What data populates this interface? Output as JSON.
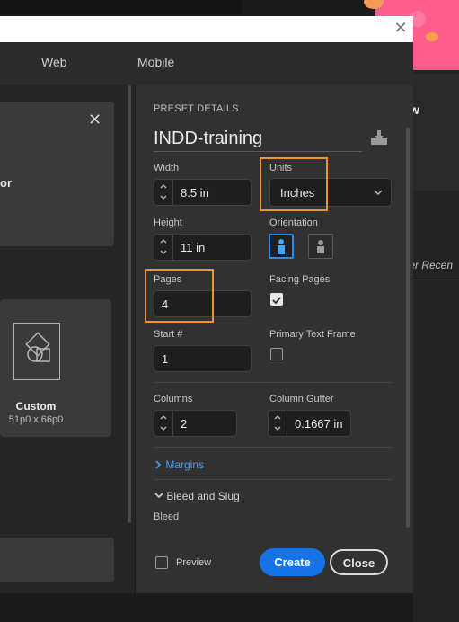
{
  "tabs": [
    "Web",
    "Mobile"
  ],
  "background": {
    "letter": "w",
    "recent_text": "ter Recen"
  },
  "left_panel": {
    "card1_text": "or",
    "card2_title": "Custom",
    "card2_subtitle": "51p0 x 66p0"
  },
  "preset": {
    "section_title": "PRESET DETAILS",
    "document_name": "INDD-training",
    "width_label": "Width",
    "width_value": "8.5 in",
    "units_label": "Units",
    "units_value": "Inches",
    "height_label": "Height",
    "height_value": "11 in",
    "orientation_label": "Orientation",
    "pages_label": "Pages",
    "pages_value": "4",
    "facing_pages_label": "Facing Pages",
    "facing_pages_checked": true,
    "start_label": "Start #",
    "start_value": "1",
    "primary_text_frame_label": "Primary Text Frame",
    "primary_text_frame_checked": false,
    "columns_label": "Columns",
    "columns_value": "2",
    "column_gutter_label": "Column Gutter",
    "column_gutter_value": "0.1667 in",
    "margins_label": "Margins",
    "bleed_slug_label": "Bleed and Slug",
    "bleed_label": "Bleed"
  },
  "footer": {
    "preview_label": "Preview",
    "create_label": "Create",
    "close_label": "Close"
  },
  "colors": {
    "accent_blue": "#1473e6",
    "highlight_orange": "#f0932a",
    "dialog_bg": "#313131"
  }
}
